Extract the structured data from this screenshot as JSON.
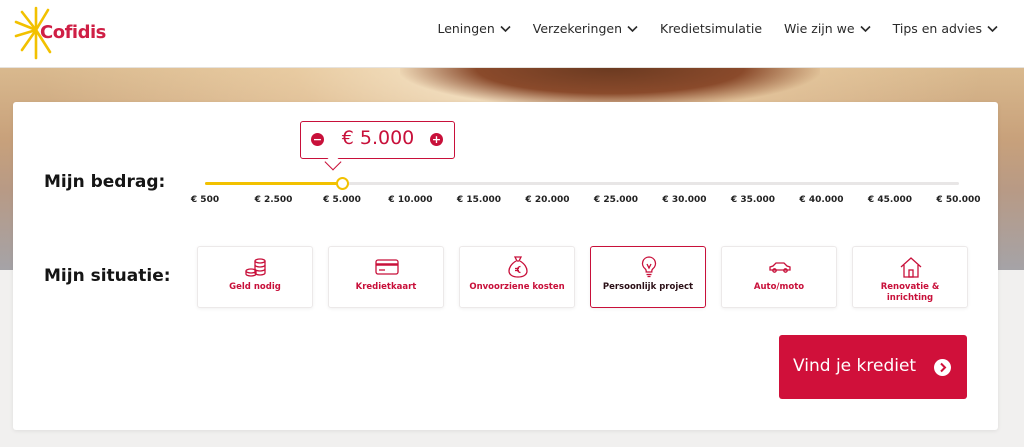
{
  "brand": {
    "name": "Cofidis",
    "primary_color": "#d0103a",
    "accent_color": "#f2c100"
  },
  "nav": [
    {
      "label": "Leningen",
      "has_dropdown": true
    },
    {
      "label": "Verzekeringen",
      "has_dropdown": true
    },
    {
      "label": "Kredietsimulatie",
      "has_dropdown": false
    },
    {
      "label": "Wie zijn we",
      "has_dropdown": true
    },
    {
      "label": "Tips en advies",
      "has_dropdown": true
    }
  ],
  "simulator": {
    "amount_label": "Mijn bedrag:",
    "amount_display": "€ 5.000",
    "amount_value": 5000,
    "slider_min": 500,
    "slider_max": 50000,
    "ticks": [
      "€ 500",
      "€ 2.500",
      "€ 5.000",
      "€ 10.000",
      "€ 15.000",
      "€ 20.000",
      "€ 25.000",
      "€ 30.000",
      "€ 35.000",
      "€ 40.000",
      "€ 45.000",
      "€ 50.000"
    ],
    "situation_label": "Mijn situatie:",
    "situations": [
      {
        "label": "Geld nodig",
        "icon": "coins-icon",
        "selected": false
      },
      {
        "label": "Kredietkaart",
        "icon": "credit-card-icon",
        "selected": false
      },
      {
        "label": "Onvoorziene kosten",
        "icon": "money-bag-euro-icon",
        "selected": false
      },
      {
        "label": "Persoonlijk project",
        "icon": "lightbulb-icon",
        "selected": true
      },
      {
        "label": "Auto/moto",
        "icon": "car-icon",
        "selected": false
      },
      {
        "label": "Renovatie & inrichting",
        "icon": "house-icon",
        "selected": false
      }
    ],
    "cta_label": "Vind je krediet"
  }
}
